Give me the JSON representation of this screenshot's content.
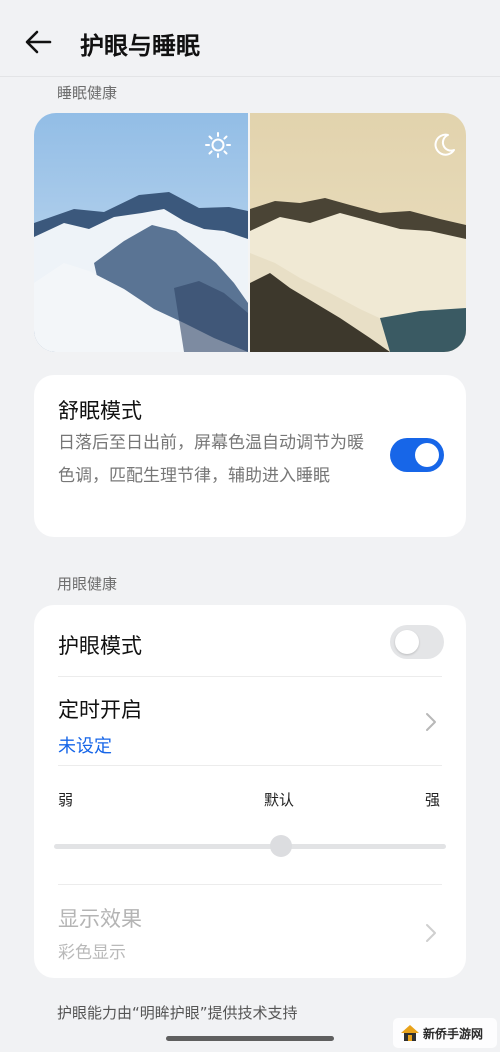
{
  "header": {
    "title": "护眼与睡眠",
    "back_icon": "arrow-left-icon"
  },
  "sleep_section": {
    "label": "睡眠健康",
    "preview": {
      "day_icon": "sun-icon",
      "night_icon": "moon-icon"
    },
    "sleep_mode": {
      "title": "舒眠模式",
      "description": "日落后至日出前，屏幕色温自动调节为暖色调，匹配生理节律，辅助进入睡眠",
      "enabled": true
    }
  },
  "eye_section": {
    "label": "用眼健康",
    "eye_mode": {
      "title": "护眼模式",
      "enabled": false
    },
    "schedule": {
      "title": "定时开启",
      "value": "未设定"
    },
    "intensity": {
      "min_label": "弱",
      "default_label": "默认",
      "max_label": "强",
      "level_fraction": 0.58
    },
    "display_effect": {
      "title": "显示效果",
      "value": "彩色显示"
    }
  },
  "footer": {
    "note": "护眼能力由“明眸护眼”提供技术支持"
  },
  "watermark": {
    "text": "新侨手游网"
  },
  "colors": {
    "accent": "#1766e8",
    "background": "#f1f2f4",
    "card": "#ffffff"
  }
}
